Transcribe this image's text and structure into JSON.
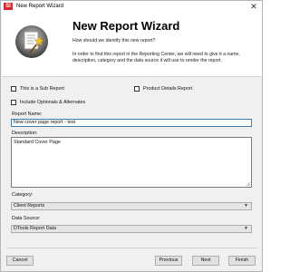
{
  "window": {
    "app_icon_text": "SI",
    "title": "New Report Wizard"
  },
  "header": {
    "title": "New Report Wizard",
    "subtitle": "How should we identify this new report?",
    "description": "In order to find this report in the Reporting Center, we will need to give it a name, description, category and the data source it will use to render the report."
  },
  "options": {
    "sub_report_label": "This is a Sub Report",
    "sub_report_checked": false,
    "product_details_label": "Product Details Report",
    "product_details_checked": false,
    "include_optionals_label": "Include Optionals & Alternates",
    "include_optionals_checked": false
  },
  "form": {
    "report_name_label": "Report Name:",
    "report_name_value": "New cover page report - test",
    "description_label": "Description:",
    "description_value": "Standard Cover Page",
    "category_label": "Category:",
    "category_value": "Client Reports",
    "data_source_label": "Data Source:",
    "data_source_value": "DTools Report Data"
  },
  "buttons": {
    "cancel": "Cancel",
    "previous": "Previous",
    "next": "Next",
    "finish": "Finish"
  },
  "icons": {
    "close": "close-icon",
    "wizard": "wizard-report-icon",
    "dropdown": "chevron-down-icon"
  }
}
